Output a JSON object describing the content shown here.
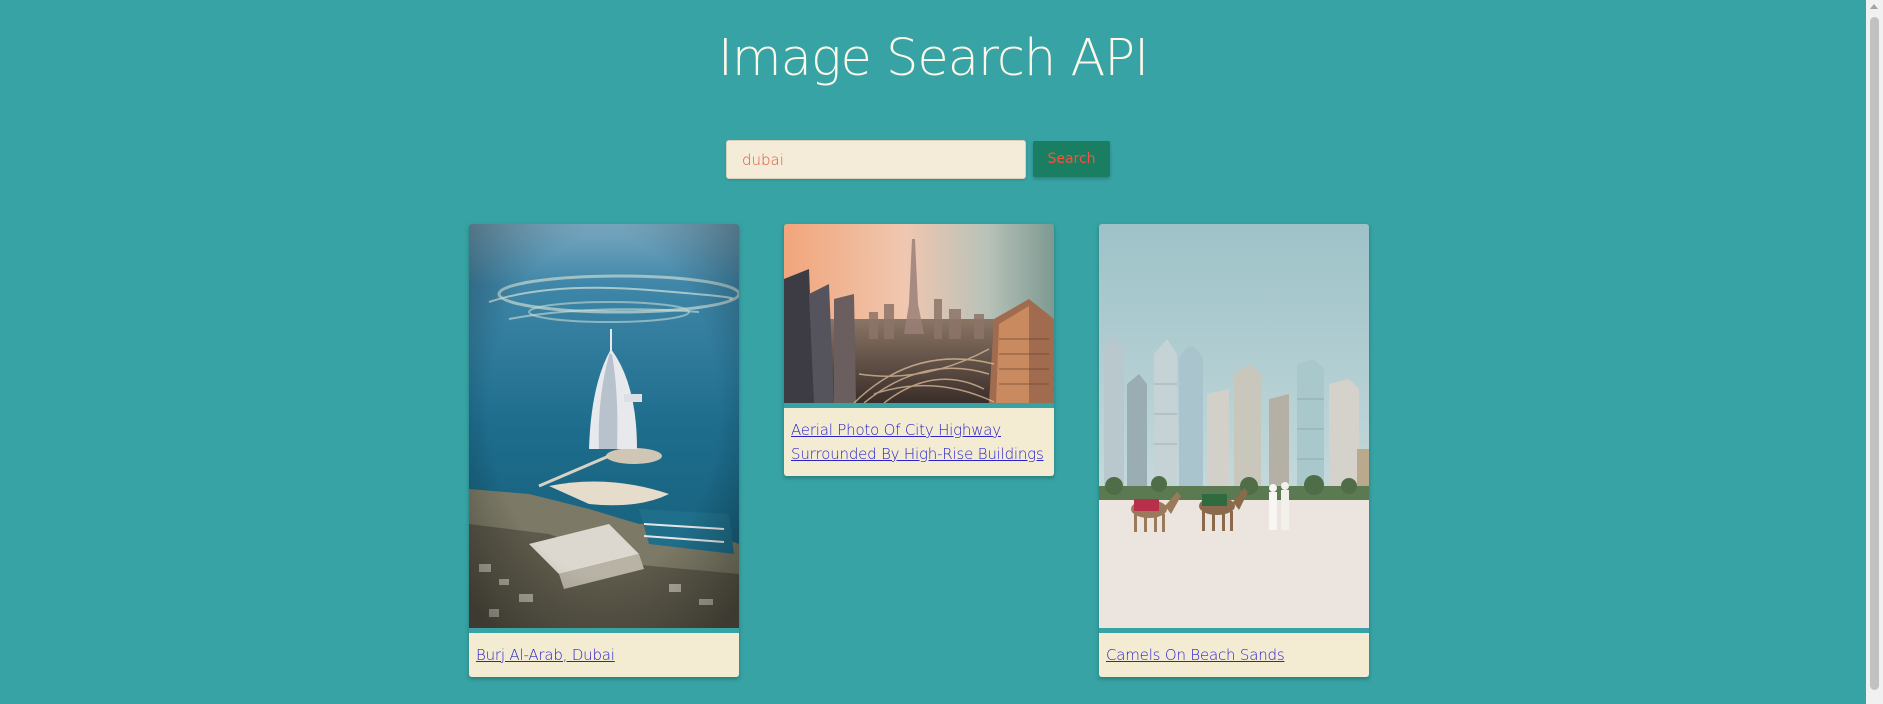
{
  "header": {
    "title": "Image Search API"
  },
  "search": {
    "value": "dubai",
    "placeholder": "",
    "button_label": "Search"
  },
  "results": [
    {
      "caption": "Burj Al-Arab, Dubai"
    },
    {
      "caption": "Aerial Photo Of City Highway Surrounded By High-Rise Buildings"
    },
    {
      "caption": "Camels On Beach Sands"
    }
  ],
  "colors": {
    "background": "#37a3a4",
    "title": "#fdf7ea",
    "input_background": "#f4ebd8",
    "input_text": "#e2553d",
    "button_background": "#1a7f62",
    "button_text": "#f2543c",
    "caption_background": "#f4ebd3",
    "link": "#2b24c9"
  }
}
